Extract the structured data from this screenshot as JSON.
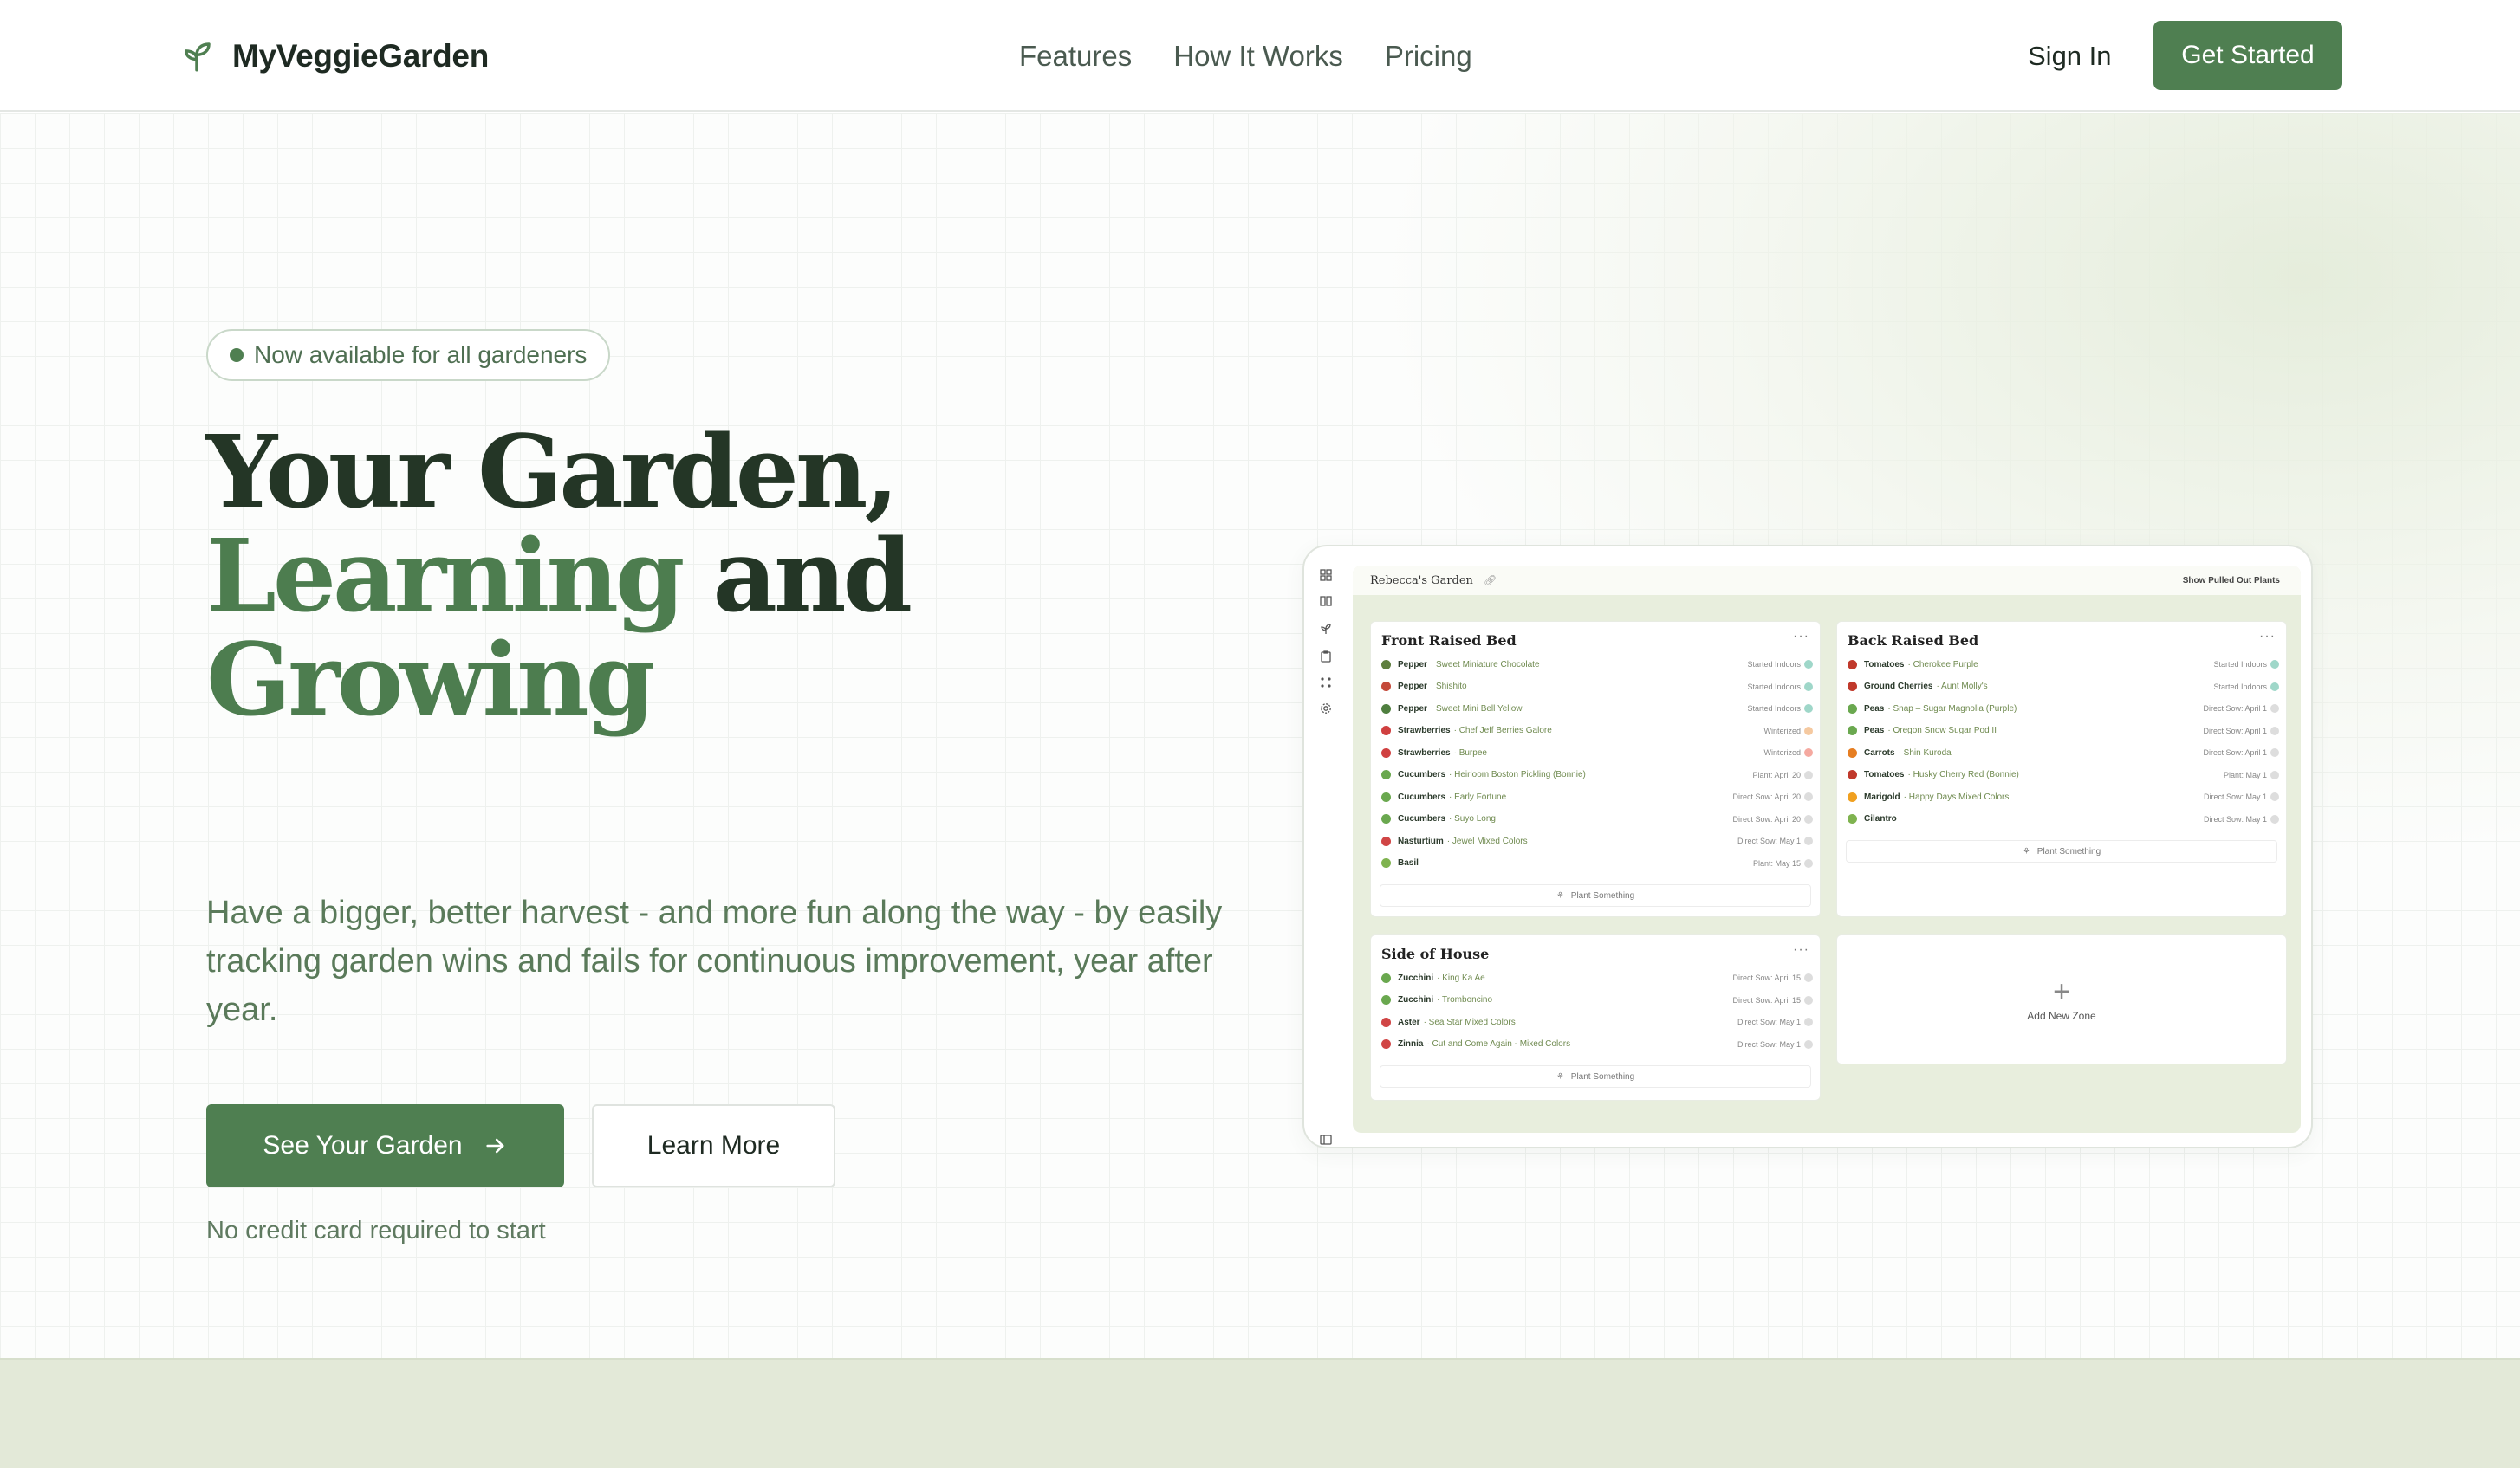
{
  "header": {
    "brand": "MyVeggieGarden",
    "nav": [
      "Features",
      "How It Works",
      "Pricing"
    ],
    "sign_in": "Sign In",
    "get_started": "Get Started"
  },
  "hero": {
    "badge": "Now available for all gardeners",
    "headline": {
      "line1": "Your Garden,",
      "line2_green": "Learning",
      "line2_dark": " and",
      "line3": "Growing"
    },
    "subtitle": "Have a bigger, better harvest - and more fun along the way - by easily tracking garden wins and fails for continuous improvement, year after year.",
    "primary_button": "See Your Garden",
    "secondary_button": "Learn More",
    "note": "No credit card required to start"
  },
  "preview": {
    "garden_name": "Rebecca's Garden",
    "show_pulled": "Show Pulled Out Plants",
    "plant_something": "Plant Something",
    "add_zone": "Add New Zone",
    "zones": {
      "front": {
        "title": "Front Raised Bed",
        "more": "···",
        "plants": [
          {
            "name": "Pepper",
            "variety": "· Sweet Miniature Chocolate",
            "status": "Started Indoors",
            "color": "#5f7f3f",
            "dot": "#9fd7c9"
          },
          {
            "name": "Pepper",
            "variety": "· Shishito",
            "status": "Started Indoors",
            "color": "#c44a3a",
            "dot": "#9fd7c9"
          },
          {
            "name": "Pepper",
            "variety": "· Sweet Mini Bell Yellow",
            "status": "Started Indoors",
            "color": "#4f7f3f",
            "dot": "#9fd7c9"
          },
          {
            "name": "Strawberries",
            "variety": "· Chef Jeff Berries Galore",
            "status": "Winterized",
            "color": "#d04040",
            "dot": "#f5c9a0"
          },
          {
            "name": "Strawberries",
            "variety": "· Burpee",
            "status": "Winterized",
            "color": "#d04040",
            "dot": "#f5a9a0"
          },
          {
            "name": "Cucumbers",
            "variety": "· Heirloom Boston Pickling (Bonnie)",
            "status": "Plant: April 20",
            "color": "#6aa84f",
            "dot": "#dddddd"
          },
          {
            "name": "Cucumbers",
            "variety": "· Early Fortune",
            "status": "Direct Sow: April 20",
            "color": "#6aa84f",
            "dot": "#dddddd"
          },
          {
            "name": "Cucumbers",
            "variety": "· Suyo Long",
            "status": "Direct Sow: April 20",
            "color": "#6aa84f",
            "dot": "#dddddd"
          },
          {
            "name": "Nasturtium",
            "variety": "· Jewel Mixed Colors",
            "status": "Direct Sow: May 1",
            "color": "#d04545",
            "dot": "#dddddd"
          },
          {
            "name": "Basil",
            "variety": "",
            "status": "Plant: May 15",
            "color": "#7fb34f",
            "dot": "#dddddd"
          }
        ]
      },
      "back": {
        "title": "Back Raised Bed",
        "more": "···",
        "plants": [
          {
            "name": "Tomatoes",
            "variety": "· Cherokee Purple",
            "status": "Started Indoors",
            "color": "#c0392b",
            "dot": "#9fd7c9"
          },
          {
            "name": "Ground Cherries",
            "variety": "· Aunt Molly's",
            "status": "Started Indoors",
            "color": "#c0392b",
            "dot": "#9fd7c9"
          },
          {
            "name": "Peas",
            "variety": "· Snap – Sugar Magnolia (Purple)",
            "status": "Direct Sow: April 1",
            "color": "#6aa84f",
            "dot": "#dddddd"
          },
          {
            "name": "Peas",
            "variety": "· Oregon Snow Sugar Pod II",
            "status": "Direct Sow: April 1",
            "color": "#6aa84f",
            "dot": "#dddddd"
          },
          {
            "name": "Carrots",
            "variety": "· Shin Kuroda",
            "status": "Direct Sow: April 1",
            "color": "#e67e22",
            "dot": "#dddddd"
          },
          {
            "name": "Tomatoes",
            "variety": "· Husky Cherry Red (Bonnie)",
            "status": "Plant: May 1",
            "color": "#c0392b",
            "dot": "#dddddd"
          },
          {
            "name": "Marigold",
            "variety": "· Happy Days Mixed Colors",
            "status": "Direct Sow: May 1",
            "color": "#f0a020",
            "dot": "#dddddd"
          },
          {
            "name": "Cilantro",
            "variety": "",
            "status": "Direct Sow: May 1",
            "color": "#7fb34f",
            "dot": "#dddddd"
          }
        ]
      },
      "side": {
        "title": "Side of House",
        "more": "···",
        "plants": [
          {
            "name": "Zucchini",
            "variety": "· King Ka Ae",
            "status": "Direct Sow: April 15",
            "color": "#6aa84f",
            "dot": "#dddddd"
          },
          {
            "name": "Zucchini",
            "variety": "· Tromboncino",
            "status": "Direct Sow: April 15",
            "color": "#6aa84f",
            "dot": "#dddddd"
          },
          {
            "name": "Aster",
            "variety": "· Sea Star Mixed Colors",
            "status": "Direct Sow: May 1",
            "color": "#d04545",
            "dot": "#dddddd"
          },
          {
            "name": "Zinnia",
            "variety": "· Cut and Come Again - Mixed Colors",
            "status": "Direct Sow: May 1",
            "color": "#d04545",
            "dot": "#dddddd"
          }
        ]
      }
    }
  },
  "colors": {
    "brand_green": "#4f7f51",
    "headline_dark": "#243626",
    "headline_green": "#4d7d4f",
    "band": "#e3e9d8"
  }
}
